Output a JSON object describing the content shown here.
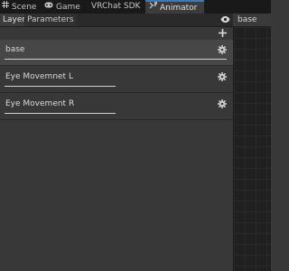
{
  "tabs": [
    {
      "label": "Scene",
      "icon": "grid-icon"
    },
    {
      "label": "Game",
      "icon": "gamepad-icon"
    },
    {
      "label": "VRChat SDK",
      "icon": ""
    },
    {
      "label": "Animator",
      "icon": "animator-icon",
      "active": true
    }
  ],
  "subtabs": {
    "layers": "Layers",
    "parameters": "Parameters",
    "active": "Layers"
  },
  "toolbar": {
    "breadcrumb": "base",
    "eye_icon": "eye-icon",
    "add_icon": "plus-icon"
  },
  "layers": [
    {
      "name": "base",
      "selected": true,
      "weight": 1.0
    },
    {
      "name": "Eye Movemnet L",
      "selected": false,
      "weight": 0.5
    },
    {
      "name": "Eye Movement R",
      "selected": false,
      "weight": 0.5
    }
  ],
  "colors": {
    "accent": "#3a79bb",
    "panel": "#383838",
    "selected_row": "#474747",
    "graph": "#202020"
  }
}
